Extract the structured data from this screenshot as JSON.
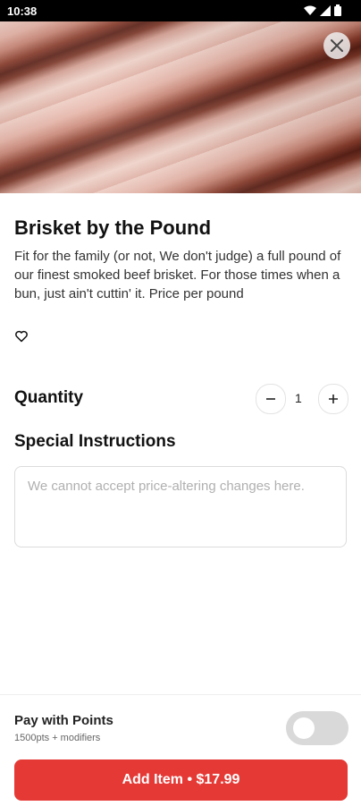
{
  "status_bar": {
    "time": "10:38",
    "icons": [
      "wifi-icon",
      "signal-icon",
      "battery-icon"
    ]
  },
  "product": {
    "title": "Brisket by the Pound",
    "description": "Fit for the family (or not, We don't judge) a full pound of our finest smoked beef brisket. For those times when a bun, just ain't cuttin' it. Price per pound",
    "favorite_icon": "heart-outline-icon"
  },
  "quantity": {
    "label": "Quantity",
    "value": "1"
  },
  "special_instructions": {
    "label": "Special Instructions",
    "placeholder": "We cannot accept price-altering changes here."
  },
  "pay_with_points": {
    "title": "Pay with Points",
    "subtitle": "1500pts + modifiers",
    "enabled": false
  },
  "add_button": {
    "label": "Add Item • $17.99"
  },
  "colors": {
    "accent": "#e53935",
    "toggle_off": "#d9d9d9"
  }
}
